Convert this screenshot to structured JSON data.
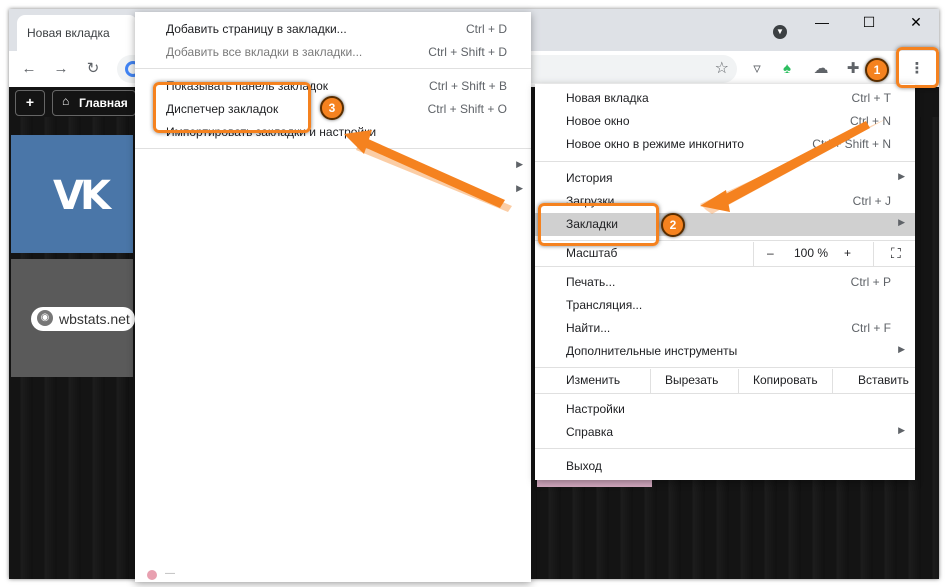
{
  "browser": {
    "tab_title": "Новая вкладка",
    "window_controls": {
      "minimize": "—",
      "maximize": "☐",
      "close": "✕"
    },
    "bookmarks_bar": {
      "add": "+",
      "home": "Главная"
    },
    "tiles": {
      "wb_label": "wbstats.net",
      "vk_logo": "vk-logo"
    }
  },
  "bookmarks_submenu": {
    "items": [
      {
        "label": "Добавить страницу в закладки...",
        "shortcut": "Ctrl + D"
      },
      {
        "label": "Добавить все вкладки в закладки...",
        "shortcut": "Ctrl + Shift + D"
      },
      {
        "label": "Показывать панель закладок",
        "shortcut": "Ctrl + Shift + B"
      },
      {
        "label": "Диспетчер закладок",
        "shortcut": "Ctrl + Shift + O"
      },
      {
        "label": "Импортировать закладки и настройки",
        "shortcut": ""
      }
    ],
    "footer": "—"
  },
  "chrome_menu": {
    "items": [
      {
        "label": "Новая вкладка",
        "shortcut": "Ctrl + T"
      },
      {
        "label": "Новое окно",
        "shortcut": "Ctrl + N"
      },
      {
        "label": "Новое окно в режиме инкогнито",
        "shortcut": "Ctrl + Shift + N"
      },
      {
        "label": "История",
        "shortcut": ""
      },
      {
        "label": "Загрузки",
        "shortcut": "Ctrl + J"
      },
      {
        "label": "Закладки",
        "shortcut": ""
      },
      {
        "label": "Масштаб",
        "shortcut": ""
      },
      {
        "label": "Печать...",
        "shortcut": "Ctrl + P"
      },
      {
        "label": "Трансляция...",
        "shortcut": ""
      },
      {
        "label": "Найти...",
        "shortcut": "Ctrl + F"
      },
      {
        "label": "Дополнительные инструменты",
        "shortcut": ""
      },
      {
        "label": "Настройки",
        "shortcut": ""
      },
      {
        "label": "Справка",
        "shortcut": ""
      },
      {
        "label": "Выход",
        "shortcut": ""
      }
    ],
    "zoom": {
      "minus": "–",
      "value": "100 %",
      "plus": "+"
    },
    "edit_row": {
      "label": "Изменить",
      "cut": "Вырезать",
      "copy": "Копировать",
      "paste": "Вставить"
    }
  },
  "annotations": {
    "step1": "1",
    "step2": "2",
    "step3": "3",
    "accent_color": "#f5821f"
  }
}
